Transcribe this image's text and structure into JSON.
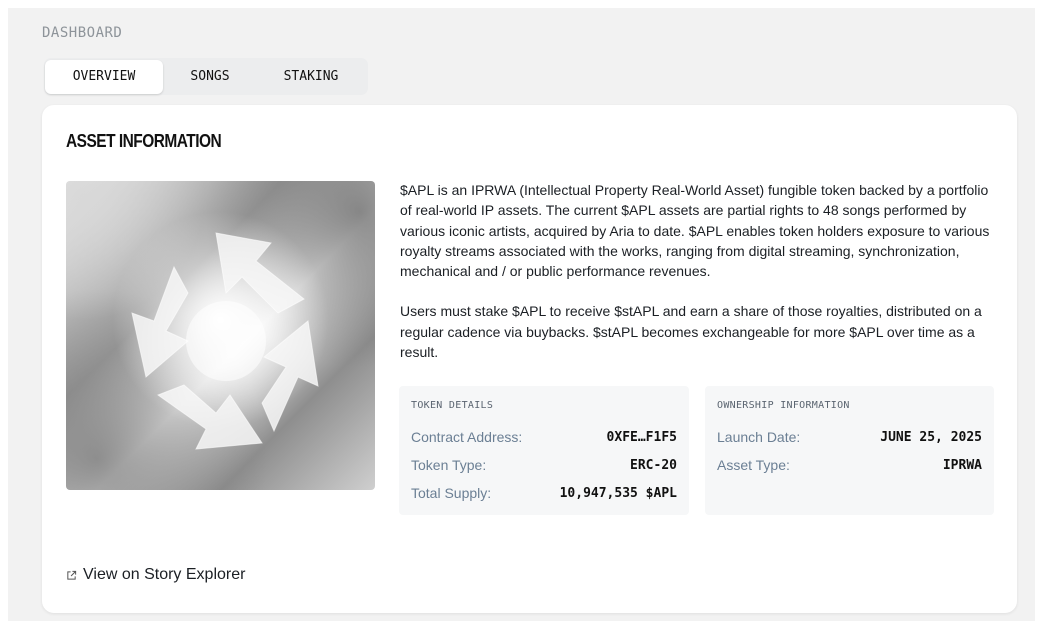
{
  "page": {
    "section_label": "DASHBOARD"
  },
  "tabs": [
    {
      "label": "OVERVIEW",
      "active": true
    },
    {
      "label": "SONGS",
      "active": false
    },
    {
      "label": "STAKING",
      "active": false
    }
  ],
  "asset_card": {
    "title": "ASSET INFORMATION",
    "artwork_icon": "recycle-arrows-logo",
    "description": [
      "$APL is an IPRWA (Intellectual Property Real-World Asset) fungible token backed by a portfolio of real-world IP assets. The current $APL assets are partial rights to 48 songs performed by various iconic artists, acquired by Aria to date. $APL enables token holders exposure to various royalty streams associated with the works, ranging from digital streaming, synchronization, mechanical and / or public performance revenues.",
      "Users must stake $APL to receive $stAPL and earn a share of those royalties, distributed on a regular cadence via buybacks. $stAPL becomes exchangeable for more $APL over time as a result."
    ],
    "token_details": {
      "label": "TOKEN DETAILS",
      "rows": [
        {
          "key": "Contract Address:",
          "value": "0XFE…F1F5"
        },
        {
          "key": "Token Type:",
          "value": "ERC-20"
        },
        {
          "key": "Total Supply:",
          "value": "10,947,535 $APL"
        }
      ]
    },
    "ownership_information": {
      "label": "OWNERSHIP INFORMATION",
      "rows": [
        {
          "key": "Launch Date:",
          "value": "JUNE 25, 2025"
        },
        {
          "key": "Asset Type:",
          "value": "IPRWA"
        }
      ]
    },
    "explorer_link": {
      "label": "View on Story Explorer",
      "icon": "external-link-icon"
    }
  },
  "colors": {
    "background": "#f2f2f2",
    "card": "#ffffff",
    "info_box": "#f6f7f8",
    "muted_text": "#6b7f94"
  }
}
